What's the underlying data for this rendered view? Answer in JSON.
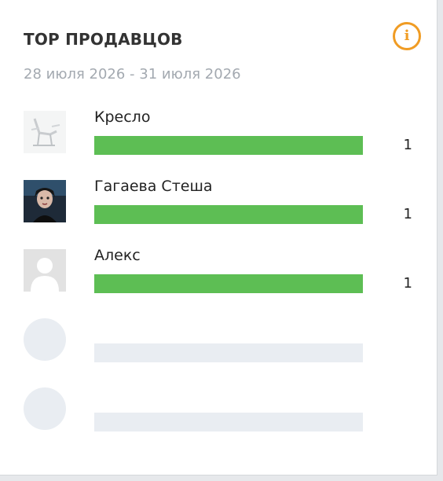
{
  "widget": {
    "title": "TOP ПРОДАВЦОВ",
    "date_range": "28 июля 2026 - 31 июля 2026",
    "info_icon": "info-icon",
    "accent_color": "#f09c24",
    "bar_color": "#5dbe54"
  },
  "sellers": [
    {
      "name": "Кресло",
      "count": "1",
      "bar_fraction": 1.0,
      "avatar": "chair-photo"
    },
    {
      "name": "Гагаева Стеша",
      "count": "1",
      "bar_fraction": 1.0,
      "avatar": "person-photo"
    },
    {
      "name": "Алекс",
      "count": "1",
      "bar_fraction": 1.0,
      "avatar": "default-user-avatar"
    }
  ]
}
